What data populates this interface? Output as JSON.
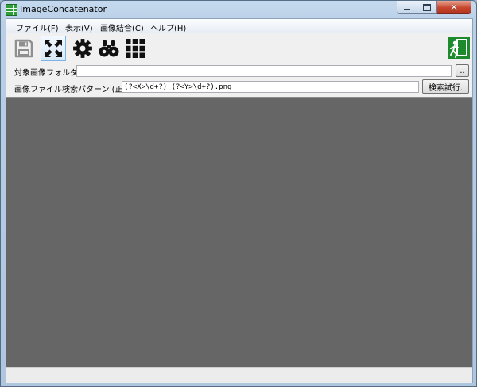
{
  "window": {
    "title": "ImageConcatenator"
  },
  "menu": {
    "items": [
      {
        "label": "ファイル(F)"
      },
      {
        "label": "表示(V)"
      },
      {
        "label": "画像結合(C)"
      },
      {
        "label": "ヘルプ(H)"
      }
    ]
  },
  "toolbar": {
    "icons": [
      "save-icon",
      "expand-icon",
      "gear-icon",
      "binoculars-icon",
      "grid-icon",
      "exit-icon"
    ]
  },
  "form": {
    "folder_label": "対象画像フォルダ",
    "folder_value": "",
    "browse_label": "..",
    "pattern_label": "画像ファイル検索パターン (正規表",
    "pattern_value": "(?<X>\\d+?)_(?<Y>\\d+?).png",
    "search_label": "検索試行."
  },
  "colors": {
    "canvas": "#666666",
    "exit_icon_bg": "#1e8a2e"
  }
}
